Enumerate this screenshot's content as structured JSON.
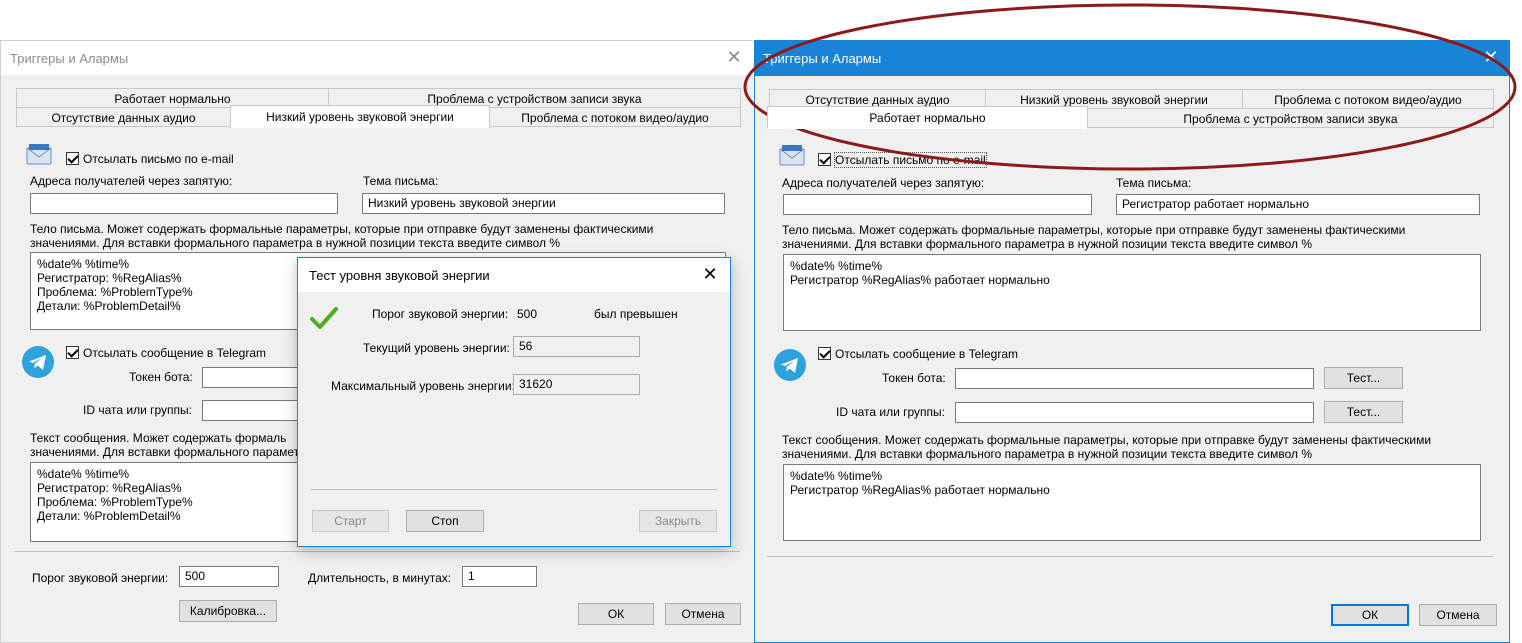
{
  "left_window": {
    "title": "Триггеры и Алармы",
    "tabs_row1": [
      "Работает нормально",
      "Проблема с устройством записи звука"
    ],
    "tabs_row2": [
      "Отсутствие данных аудио",
      "Низкий уровень звуковой энергии",
      "Проблема с потоком видео/аудио"
    ],
    "active_tab": "Низкий уровень звуковой энергии",
    "email_checkbox_label": "Отсылать письмо по e-mail",
    "recipients_label": "Адреса получателей через запятую:",
    "recipients_value": "",
    "subject_label": "Тема письма:",
    "subject_value": "Низкий уровень звуковой энергии",
    "body_hint_line1": "Тело письма. Может содержать формальные параметры, которые при отправке будут заменены фактическими",
    "body_hint_line2": "значениями. Для вставки формального параметра в нужной позиции текста введите символ %",
    "body_text": "%date% %time%\nРегистратор: %RegAlias%\nПроблема: %ProblemType%\nДетали: %ProblemDetail%",
    "telegram_checkbox_label": "Отсылать сообщение в Telegram",
    "bot_token_label": "Токен бота:",
    "bot_token_value": "",
    "chat_id_label": "ID чата или группы:",
    "chat_id_value": "",
    "msg_hint_line1": "Текст сообщения. Может содержать формаль",
    "msg_hint_line2": "значениями. Для вставки формального параметр",
    "msg_text": "%date% %time%\nРегистратор: %RegAlias%\nПроблема: %ProblemType%\nДетали: %ProblemDetail%",
    "threshold_label": "Порог звуковой энергии:",
    "threshold_value": "500",
    "duration_label": "Длительность, в минутах:",
    "duration_value": "1",
    "calibrate_button": "Калибровка...",
    "ok_button": "ОК",
    "cancel_button": "Отмена"
  },
  "test_dialog": {
    "title": "Тест уровня звуковой энергии",
    "threshold_label": "Порог звуковой энергии:",
    "threshold_value": "500",
    "threshold_status": "был превышен",
    "current_label": "Текущий уровень энергии:",
    "current_value": "56",
    "max_label": "Максимальный уровень энергии:",
    "max_value": "31620",
    "start_button": "Старт",
    "stop_button": "Стоп",
    "close_button": "Закрыть"
  },
  "right_window": {
    "title": "Триггеры и Алармы",
    "tabs_row1": [
      "Отсутствие данных аудио",
      "Низкий уровень звуковой энергии",
      "Проблема с потоком видео/аудио"
    ],
    "tabs_row2": [
      "Работает нормально",
      "Проблема с устройством записи звука"
    ],
    "active_tab": "Работает нормально",
    "email_checkbox_label": "Отсылать письмо по e-mail",
    "recipients_label": "Адреса получателей через запятую:",
    "recipients_value": "",
    "subject_label": "Тема письма:",
    "subject_value": "Регистратор работает нормально",
    "body_hint_line1": "Тело письма. Может содержать формальные параметры, которые при отправке будут заменены фактическими",
    "body_hint_line2": "значениями. Для вставки формального параметра в нужной позиции текста введите символ %",
    "body_text": "%date% %time%\nРегистратор %RegAlias% работает нормально",
    "telegram_checkbox_label": "Отсылать сообщение в Telegram",
    "bot_token_label": "Токен бота:",
    "bot_token_value": "",
    "chat_id_label": "ID чата или группы:",
    "chat_id_value": "",
    "test_button": "Тест...",
    "msg_hint_line1": "Текст сообщения. Может содержать формальные параметры, которые при отправке будут заменены фактическими",
    "msg_hint_line2": "значениями. Для вставки формального параметра в нужной позиции текста введите символ %",
    "msg_text": "%date% %time%\nРегистратор %RegAlias% работает нормально",
    "ok_button": "ОК",
    "cancel_button": "Отмена"
  },
  "colors": {
    "highlight_ellipse": "#8b1a1a",
    "active_window_border": "#1883d7",
    "ok_check": "#4caf1e",
    "telegram_blue": "#2ea3db"
  },
  "icons": {
    "email": "envelope-icon",
    "telegram": "telegram-icon",
    "success": "checkmark-icon"
  }
}
